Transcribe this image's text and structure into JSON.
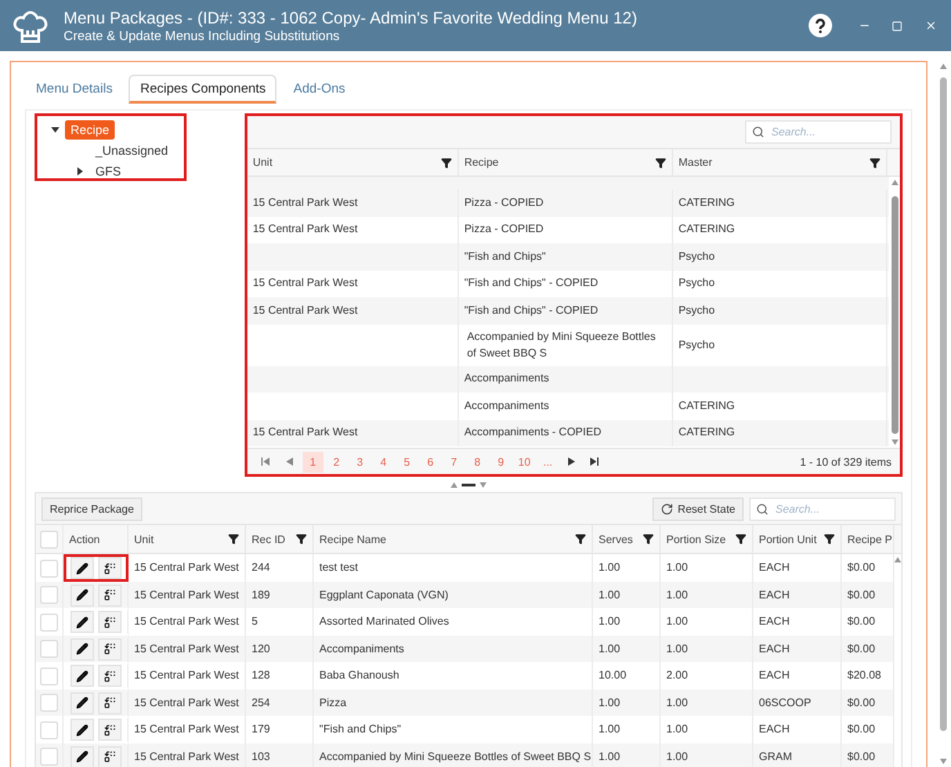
{
  "window": {
    "title": "Menu Packages - (ID#: 333 - 1062 Copy- Admin's Favorite Wedding Menu 12)",
    "subtitle": "Create & Update Menus Including Substitutions"
  },
  "tabs": [
    {
      "label": "Menu Details",
      "selected": false
    },
    {
      "label": "Recipes Components",
      "selected": true
    },
    {
      "label": "Add-Ons",
      "selected": false
    }
  ],
  "tree": {
    "highlighted": true,
    "items": [
      {
        "label": "Recipe",
        "selected": true,
        "expandable": true,
        "expanded": true,
        "children": [
          {
            "label": "_Unassigned",
            "selected": false,
            "expandable": false
          },
          {
            "label": "GFS",
            "selected": false,
            "expandable": true,
            "expanded": false
          }
        ]
      }
    ]
  },
  "recipes_grid": {
    "highlighted": true,
    "search": {
      "placeholder": "Search..."
    },
    "columns": [
      {
        "label": "Unit",
        "filter": true
      },
      {
        "label": "Recipe",
        "filter": true
      },
      {
        "label": "Master",
        "filter": true
      }
    ],
    "rows": [
      {
        "unit": "15 Central Park West",
        "recipe": "Pizza - COPIED",
        "master": "CATERING"
      },
      {
        "unit": "15 Central Park West",
        "recipe": "Pizza - COPIED",
        "master": "CATERING"
      },
      {
        "recipe": "\"Fish and Chips\"",
        "master": "Psycho"
      },
      {
        "unit": "15 Central Park West",
        "recipe": "\"Fish and Chips\" - COPIED",
        "master": "Psycho"
      },
      {
        "unit": "15 Central Park West",
        "recipe": "\"Fish and Chips\" - COPIED",
        "master": "Psycho"
      },
      {
        "recipe": "Accompanied by Mini Squeeze Bottles of Sweet BBQ S",
        "master": "Psycho"
      },
      {
        "recipe": "Accompaniments"
      },
      {
        "recipe": "Accompaniments",
        "master": "CATERING"
      },
      {
        "unit": "15 Central Park West",
        "recipe": "Accompaniments - COPIED",
        "master": "CATERING"
      }
    ],
    "pager": {
      "pages": [
        {
          "label": "1",
          "selected": true
        },
        {
          "label": "2",
          "selected": false
        },
        {
          "label": "3",
          "selected": false
        },
        {
          "label": "4",
          "selected": false
        },
        {
          "label": "5",
          "selected": false
        },
        {
          "label": "6",
          "selected": false
        },
        {
          "label": "7",
          "selected": false
        },
        {
          "label": "8",
          "selected": false
        },
        {
          "label": "9",
          "selected": false
        },
        {
          "label": "10",
          "selected": false
        }
      ],
      "ellipsis": "...",
      "summary": "1 - 10 of 329 items"
    }
  },
  "components": {
    "select_all_checked": false,
    "reprice_button": "Reprice Package",
    "reset_button": "Reset State",
    "search": {
      "placeholder": "Search..."
    },
    "columns": [
      {
        "label": "Action",
        "filter": false
      },
      {
        "label": "Unit",
        "filter": true
      },
      {
        "label": "Rec ID",
        "filter": true
      },
      {
        "label": "Recipe Name",
        "filter": true
      },
      {
        "label": "Serves",
        "filter": true
      },
      {
        "label": "Portion Size",
        "filter": true
      },
      {
        "label": "Portion Unit",
        "filter": true
      },
      {
        "label": "Recipe P",
        "filter": false
      }
    ],
    "rows": [
      {
        "checked": false,
        "action_highlighted": true,
        "unit": "15 Central Park West",
        "rec_id": "244",
        "recipe_name": "test test",
        "serves": "1.00",
        "portion_size": "1.00",
        "portion_unit": "EACH",
        "recipe_price": "$0.00"
      },
      {
        "checked": false,
        "action_highlighted": false,
        "unit": "15 Central Park West",
        "rec_id": "189",
        "recipe_name": "Eggplant Caponata (VGN)",
        "serves": "1.00",
        "portion_size": "1.00",
        "portion_unit": "EACH",
        "recipe_price": "$0.00"
      },
      {
        "checked": false,
        "action_highlighted": false,
        "unit": "15 Central Park West",
        "rec_id": "5",
        "recipe_name": "Assorted Marinated Olives",
        "serves": "1.00",
        "portion_size": "1.00",
        "portion_unit": "EACH",
        "recipe_price": "$0.00"
      },
      {
        "checked": false,
        "action_highlighted": false,
        "unit": "15 Central Park West",
        "rec_id": "120",
        "recipe_name": "Accompaniments",
        "serves": "1.00",
        "portion_size": "1.00",
        "portion_unit": "EACH",
        "recipe_price": "$0.00"
      },
      {
        "checked": false,
        "action_highlighted": false,
        "unit": "15 Central Park West",
        "rec_id": "128",
        "recipe_name": "Baba Ghanoush",
        "serves": "10.00",
        "portion_size": "2.00",
        "portion_unit": "EACH",
        "recipe_price": "$20.08"
      },
      {
        "checked": false,
        "action_highlighted": false,
        "unit": "15 Central Park West",
        "rec_id": "254",
        "recipe_name": "Pizza",
        "serves": "1.00",
        "portion_size": "1.00",
        "portion_unit": "06SCOOP",
        "recipe_price": "$0.00"
      },
      {
        "checked": false,
        "action_highlighted": false,
        "unit": "15 Central Park West",
        "rec_id": "179",
        "recipe_name": "\"Fish and Chips\"",
        "serves": "1.00",
        "portion_size": "1.00",
        "portion_unit": "EACH",
        "recipe_price": "$0.00"
      },
      {
        "checked": false,
        "action_highlighted": false,
        "unit": "15 Central Park West",
        "rec_id": "103",
        "recipe_name": "Accompanied by Mini Squeeze Bottles of Sweet BBQ S",
        "serves": "1.00",
        "portion_size": "1.00",
        "portion_unit": "GRAM",
        "recipe_price": "$0.00"
      }
    ]
  }
}
